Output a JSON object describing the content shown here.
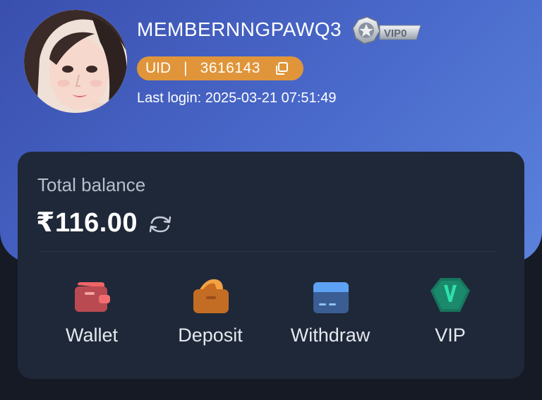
{
  "profile": {
    "username": "MEMBERNNGPAWQ3",
    "vip_level": "VIP0",
    "uid_label": "UID",
    "uid_separator": "|",
    "uid_value": "3616143",
    "last_login": "Last login: 2025-03-21 07:51:49"
  },
  "balance": {
    "label": "Total balance",
    "amount": "₹116.00"
  },
  "actions": [
    {
      "label": "Wallet",
      "icon": "wallet-icon",
      "color": "#e0585c"
    },
    {
      "label": "Deposit",
      "icon": "deposit-icon",
      "color": "#e38b2f"
    },
    {
      "label": "Withdraw",
      "icon": "withdraw-icon",
      "color": "#4d93f1"
    },
    {
      "label": "VIP",
      "icon": "vip-icon",
      "color": "#1fa67f"
    }
  ],
  "colors": {
    "header_gradient_start": "#3a4fae",
    "header_gradient_end": "#5b82dc",
    "card_bg": "#1f2838",
    "page_bg": "#151a25",
    "uid_pill": "#e0953a"
  }
}
